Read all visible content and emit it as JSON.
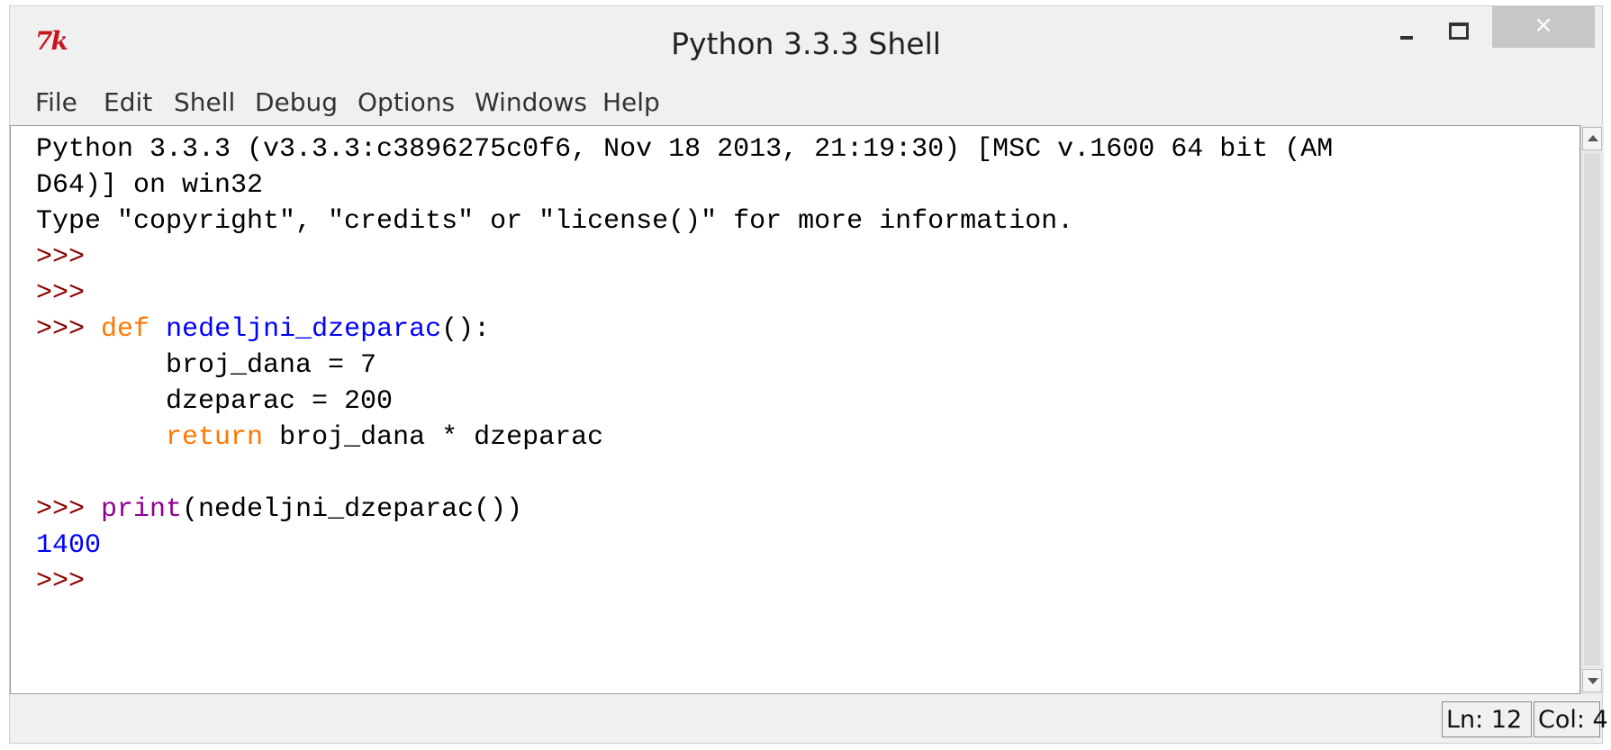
{
  "window": {
    "title": "Python 3.3.3 Shell",
    "icon_name": "tk-icon",
    "icon_text": "7k",
    "close_glyph": "×"
  },
  "menu": [
    "File",
    "Edit",
    "Shell",
    "Debug",
    "Options",
    "Windows",
    "Help"
  ],
  "shell": {
    "banner_line1": "Python 3.3.3 (v3.3.3:c3896275c0f6, Nov 18 2013, 21:19:30) [MSC v.1600 64 bit (AM",
    "banner_line2": "D64)] on win32",
    "banner_line3": "Type \"copyright\", \"credits\" or \"license()\" for more information.",
    "prompt": ">>>",
    "kw_def": "def",
    "func_name": "nedeljni_dzeparac",
    "def_tail": "():",
    "line_broj": "        broj_dana = 7",
    "line_dzep": "        dzeparac = 200",
    "indent": "        ",
    "kw_return": "return",
    "return_tail": " broj_dana * dzeparac",
    "builtin_print": "print",
    "print_tail": "(nedeljni_dzeparac())",
    "output": "1400"
  },
  "colors": {
    "keyword": "#ff7700",
    "definition": "#0000ff",
    "builtin": "#900090",
    "output": "#0000ff",
    "prompt": "#8b0000"
  },
  "status": {
    "ln": "Ln: 12",
    "col": "Col: 4"
  }
}
